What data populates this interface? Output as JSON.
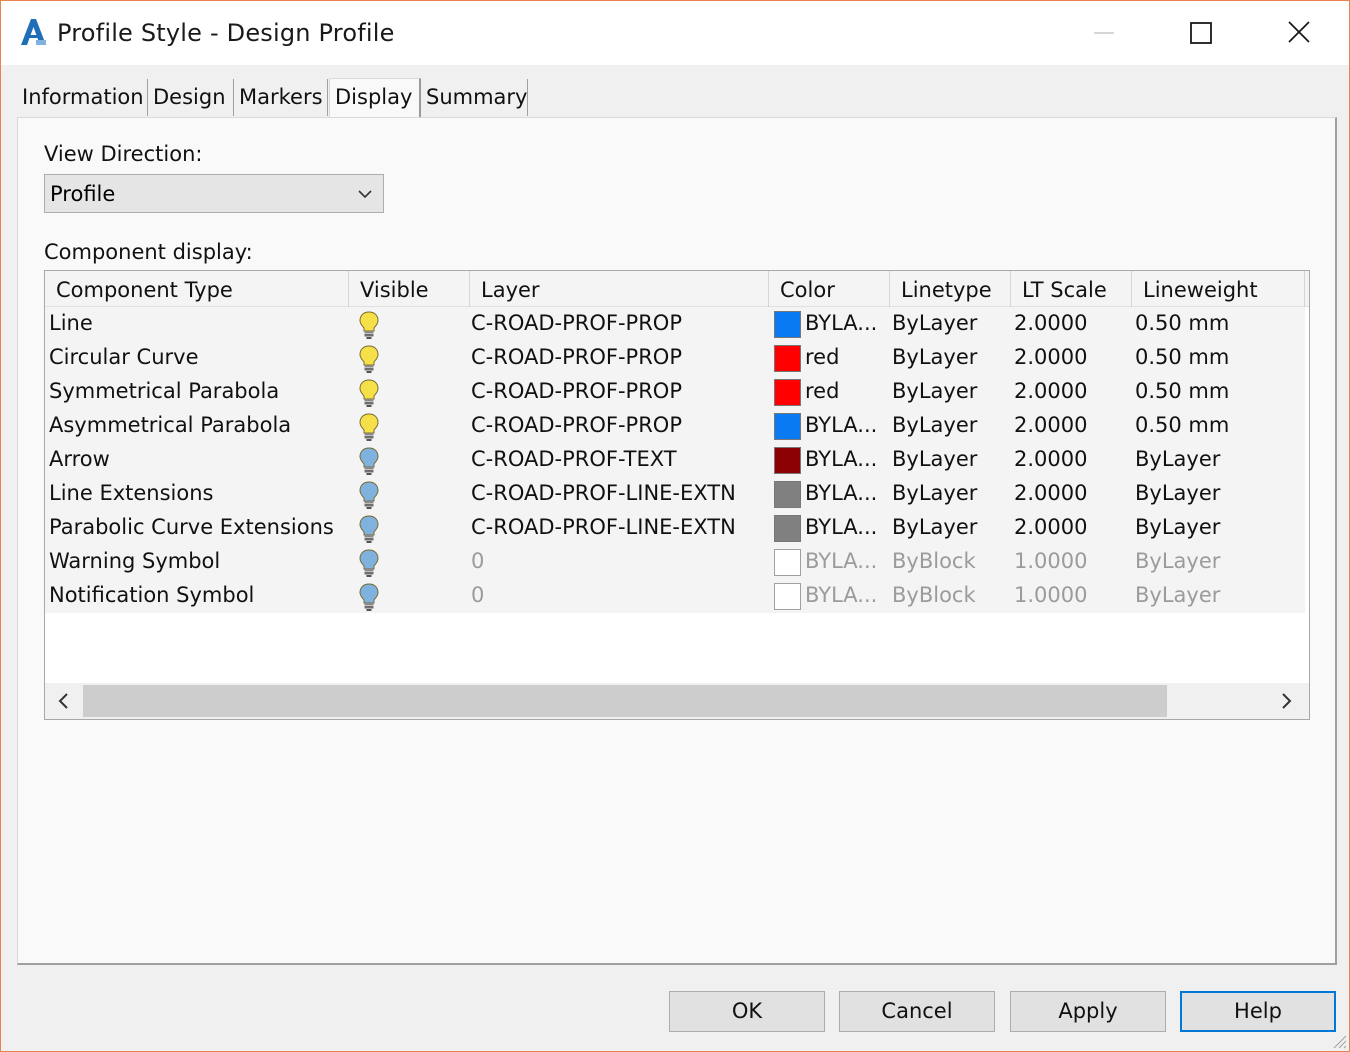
{
  "window": {
    "title": "Profile Style - Design Profile",
    "app_icon": "autocad-civil3d-icon",
    "controls": [
      "minimize-icon",
      "maximize-icon",
      "close-icon"
    ]
  },
  "tabs": [
    {
      "label": "Information",
      "active": false
    },
    {
      "label": "Design",
      "active": false
    },
    {
      "label": "Markers",
      "active": false
    },
    {
      "label": "Display",
      "active": true
    },
    {
      "label": "Summary",
      "active": false
    }
  ],
  "view_direction": {
    "label": "View Direction:",
    "value": "Profile"
  },
  "component_display": {
    "label": "Component display:",
    "columns": [
      "Component Type",
      "Visible",
      "Layer",
      "Color",
      "Linetype",
      "LT Scale",
      "Lineweight"
    ],
    "rows": [
      {
        "type": "Line",
        "visible": "on",
        "layer": "C-ROAD-PROF-PROP",
        "color_label": "BYLA...",
        "swatch": "#0a7af2",
        "linetype": "ByLayer",
        "lt_scale": "2.0000",
        "lineweight": "0.50 mm",
        "dim": false
      },
      {
        "type": "Circular Curve",
        "visible": "on",
        "layer": "C-ROAD-PROF-PROP",
        "color_label": "red",
        "swatch": "#ff0000",
        "linetype": "ByLayer",
        "lt_scale": "2.0000",
        "lineweight": "0.50 mm",
        "dim": false
      },
      {
        "type": "Symmetrical Parabola",
        "visible": "on",
        "layer": "C-ROAD-PROF-PROP",
        "color_label": "red",
        "swatch": "#ff0000",
        "linetype": "ByLayer",
        "lt_scale": "2.0000",
        "lineweight": "0.50 mm",
        "dim": false
      },
      {
        "type": "Asymmetrical Parabola",
        "visible": "on",
        "layer": "C-ROAD-PROF-PROP",
        "color_label": "BYLA...",
        "swatch": "#0a7af2",
        "linetype": "ByLayer",
        "lt_scale": "2.0000",
        "lineweight": "0.50 mm",
        "dim": false
      },
      {
        "type": "Arrow",
        "visible": "off",
        "layer": "C-ROAD-PROF-TEXT",
        "color_label": "BYLA...",
        "swatch": "#8b0000",
        "linetype": "ByLayer",
        "lt_scale": "2.0000",
        "lineweight": "ByLayer",
        "dim": false
      },
      {
        "type": "Line Extensions",
        "visible": "off",
        "layer": "C-ROAD-PROF-LINE-EXTN",
        "color_label": "BYLA...",
        "swatch": "#808080",
        "linetype": "ByLayer",
        "lt_scale": "2.0000",
        "lineweight": "ByLayer",
        "dim": false
      },
      {
        "type": "Parabolic Curve Extensions",
        "visible": "off",
        "layer": "C-ROAD-PROF-LINE-EXTN",
        "color_label": "BYLA...",
        "swatch": "#808080",
        "linetype": "ByLayer",
        "lt_scale": "2.0000",
        "lineweight": "ByLayer",
        "dim": false
      },
      {
        "type": "Warning Symbol",
        "visible": "off",
        "layer": "0",
        "color_label": "BYLA...",
        "swatch": "#ffffff",
        "linetype": "ByBlock",
        "lt_scale": "1.0000",
        "lineweight": "ByLayer",
        "dim": true
      },
      {
        "type": "Notification Symbol",
        "visible": "off",
        "layer": "0",
        "color_label": "BYLA...",
        "swatch": "#ffffff",
        "linetype": "ByBlock",
        "lt_scale": "1.0000",
        "lineweight": "ByLayer",
        "dim": true
      }
    ]
  },
  "buttons": {
    "ok": "OK",
    "cancel": "Cancel",
    "apply": "Apply",
    "help": "Help"
  },
  "colors": {
    "bulb_on": "#f5e04a",
    "bulb_off": "#7fb2de",
    "focus_border": "#0078d7",
    "window_border": "#e8834f"
  }
}
